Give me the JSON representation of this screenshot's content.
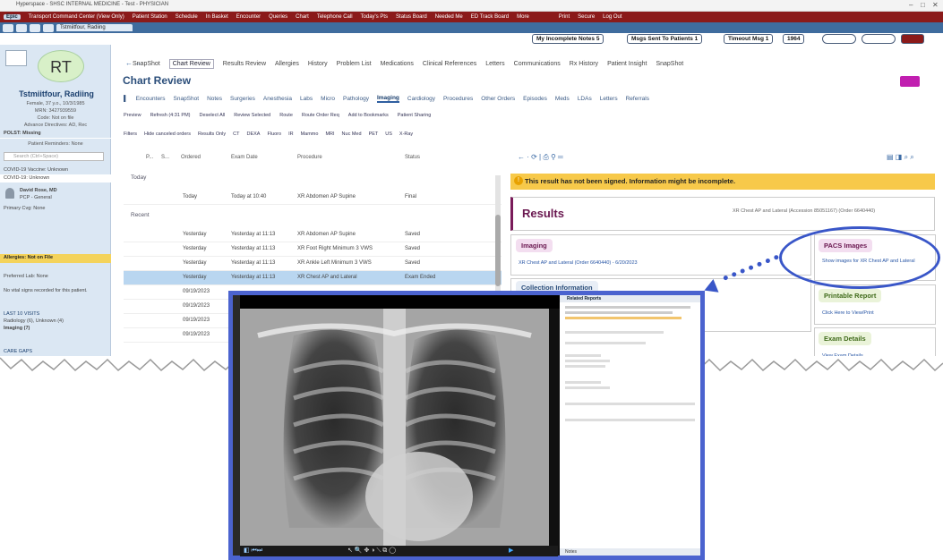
{
  "window": {
    "title": "Hyperspace - SHSC INTERNAL MEDICINE - Test - PHYSICIAN"
  },
  "topbar": {
    "logo": "Epic",
    "items": [
      "Transport Command Center (View Only)",
      "Patient Station",
      "Schedule",
      "In Basket",
      "Encounter",
      "Queries",
      "Chart",
      "Telephone Call",
      "Today's Pts",
      "Status Board",
      "Needed Me",
      "ED Track Board",
      "More"
    ],
    "right": [
      "Print",
      "Secure",
      "Log Out"
    ]
  },
  "tabbar": {
    "patient_tab": "Tstmiitfour, Radiing"
  },
  "counters": {
    "incomplete_notes": "My Incomplete Notes 5",
    "msgs_sent": "Msgs Sent To Patients 1",
    "timeout": "Timeout Msg 1",
    "mail_count": "1964"
  },
  "patient": {
    "initials": "RT",
    "name": "Tstmiitfour, Radiing",
    "demographics": "Female, 37 y.o., 10/3/1985",
    "mrn": "MRN: 3427939559",
    "code": "Code: Not on file",
    "advance": "Advance Directives: AD, Rec",
    "polst": "POLST: Missing",
    "reminders": "Patient Reminders: None",
    "search_placeholder": "Search (Ctrl+Space)",
    "covid_vaccine": "COVID-19 Vaccine: Unknown",
    "covid": "COVID-19: Unknown",
    "pcp_name": "David Rose, MD",
    "pcp_role": "PCP - General",
    "primary_cvg": "Primary Cvg: None",
    "allergies": "Allergies: Not on File",
    "preferred_lab": "Preferred Lab: None",
    "vitals": "No vital signs recorded for this patient.",
    "last_visits": "LAST 10 VISITS",
    "radiology": "Radiology (6), Unknown (4)",
    "imaging": "Imaging (7)",
    "care_gaps": "CARE GAPS"
  },
  "activity_tabs": [
    "SnapShot",
    "Chart Review",
    "Results Review",
    "Allergies",
    "History",
    "Problem List",
    "Medications",
    "Clinical References",
    "Letters",
    "Communications",
    "Rx History",
    "Patient Insight",
    "SnapShot"
  ],
  "active_activity_tab": "Chart Review",
  "chart_review": {
    "title": "Chart Review",
    "subtabs": [
      "Encounters",
      "SnapShot",
      "Notes",
      "Surgeries",
      "Anesthesia",
      "Labs",
      "Micro",
      "Pathology",
      "Imaging",
      "Cardiology",
      "Procedures",
      "Other Orders",
      "Episodes",
      "Meds",
      "LDAs",
      "Letters",
      "Referrals"
    ],
    "active_subtab": "Imaging",
    "toolbar": [
      "Preview",
      "Refresh (4:31 PM)",
      "Deselect All",
      "Review Selected",
      "Route",
      "Route Order Req",
      "Add to Bookmarks",
      "Patient Sharing"
    ],
    "filters": [
      "Filters",
      "Hide canceled orders",
      "Results Only",
      "CT",
      "DEXA",
      "Fluoro",
      "IR",
      "Mammo",
      "MRI",
      "Nuc Med",
      "PET",
      "US",
      "X-Ray"
    ],
    "columns": [
      "P...",
      "S...",
      "Ordered",
      "Exam Date",
      "Procedure",
      "Status"
    ],
    "groups": [
      "Today",
      "Recent"
    ],
    "rows_today": [
      {
        "ordered": "Today",
        "exam_date": "Today at 10:40",
        "procedure": "XR Abdomen AP Supine",
        "status": "Final"
      }
    ],
    "rows_recent": [
      {
        "ordered": "Yesterday",
        "exam_date": "Yesterday at 11:13",
        "procedure": "XR Abdomen AP Supine",
        "status": "Saved"
      },
      {
        "ordered": "Yesterday",
        "exam_date": "Yesterday at 11:13",
        "procedure": "XR Foot Right Minimum 3 VWS",
        "status": "Saved"
      },
      {
        "ordered": "Yesterday",
        "exam_date": "Yesterday at 11:13",
        "procedure": "XR Ankle Left Minimum 3 VWS",
        "status": "Saved"
      },
      {
        "ordered": "Yesterday",
        "exam_date": "Yesterday at 11:13",
        "procedure": "XR Chest AP and Lateral",
        "status": "Exam Ended"
      },
      {
        "ordered": "09/19/2023",
        "exam_date": "",
        "procedure": "",
        "status": ""
      },
      {
        "ordered": "09/19/2023",
        "exam_date": "",
        "procedure": "",
        "status": ""
      },
      {
        "ordered": "09/19/2023",
        "exam_date": "",
        "procedure": "",
        "status": ""
      },
      {
        "ordered": "09/19/2023",
        "exam_date": "",
        "procedure": "",
        "status": ""
      }
    ]
  },
  "results_panel": {
    "warning": "This result has not been signed. Information might be incomplete.",
    "title": "Results",
    "meta": "XR Chest AP and Lateral (Accession 85051167) (Order 6640440)",
    "imaging_label": "Imaging",
    "imaging_link": "XR Chest AP and Lateral (Order 6640440) - 6/20/2023",
    "collection_label": "Collection Information",
    "pacs_label": "PACS Images",
    "pacs_link": "Show images for XR Chest AP and Lateral",
    "printable_label": "Printable Report",
    "printable_link": "Click Here to View/Print",
    "exam_label": "Exam Details",
    "exam_link": "View Exam Details"
  },
  "viewer": {
    "panel_title": "Related Reports",
    "footer": "Notes"
  },
  "colors": {
    "epic_red": "#8b1a1a",
    "epic_blue": "#3f6c9e",
    "highlight": "#3956c8",
    "warning": "#f7c94a",
    "accent_magenta": "#7a1b5a"
  }
}
